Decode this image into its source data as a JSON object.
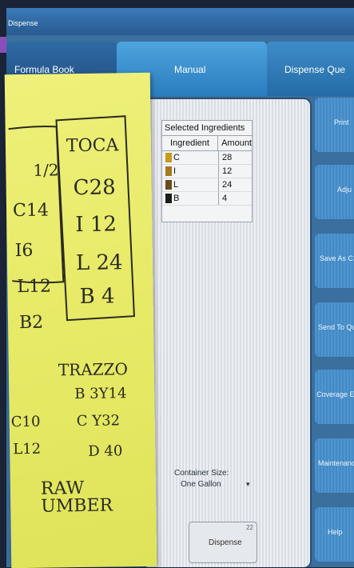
{
  "window": {
    "title": "Dispense"
  },
  "tabs": [
    {
      "label": "Formula Book"
    },
    {
      "label": "Manual"
    },
    {
      "label": "Dispense Que"
    }
  ],
  "ingredients": {
    "title": "Selected Ingredients",
    "headers": {
      "ingredient": "Ingredient",
      "amount": "Amount"
    },
    "rows": [
      {
        "name": "C",
        "amount": "28",
        "color": "#c79a18"
      },
      {
        "name": "I",
        "amount": "12",
        "color": "#a8781f"
      },
      {
        "name": "L",
        "amount": "24",
        "color": "#6a4a1e"
      },
      {
        "name": "B",
        "amount": "4",
        "color": "#1c1c1c"
      }
    ]
  },
  "container": {
    "label": "Container Size:",
    "value": "One Gallon"
  },
  "dispense": {
    "label": "Dispense",
    "count": "22"
  },
  "sidebar": [
    {
      "label": "Print"
    },
    {
      "label": "Adju"
    },
    {
      "label": "Save As C"
    },
    {
      "label": "Send To Qu"
    },
    {
      "label": "Coverage Esti"
    },
    {
      "label": "Maintenance"
    },
    {
      "label": "Help"
    }
  ],
  "note": {
    "col1": [
      "1/2",
      "C14",
      "I6",
      "L12",
      "B2"
    ],
    "col2_title": "TOCA",
    "col2": [
      "C28",
      "I 12",
      "L 24",
      "B 4"
    ],
    "trazzo": "TRAZZO",
    "trazzo_lines": [
      "B 3Y14",
      "C Y32",
      "D 40"
    ],
    "bottom_left": [
      "C10",
      "L12"
    ],
    "raw_umber": "RAW UMBER"
  }
}
